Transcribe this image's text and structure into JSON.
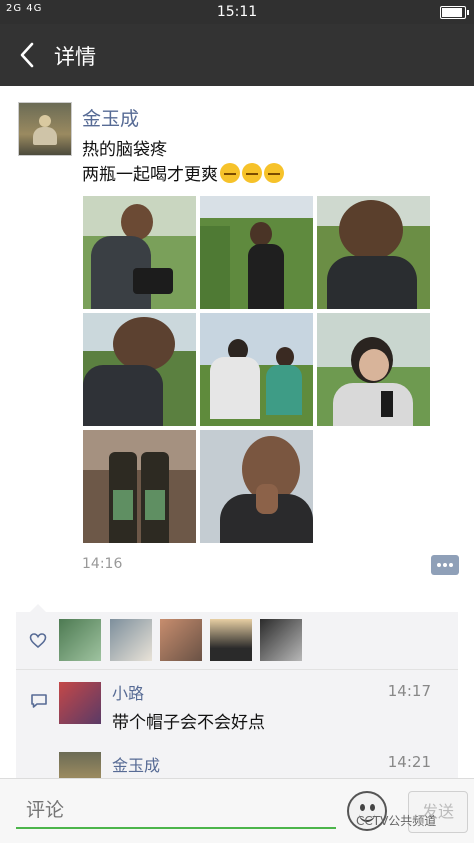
{
  "status_bar": {
    "signal": "2G 4G",
    "time": "15:11",
    "battery_level": 0.85
  },
  "nav": {
    "title": "详情"
  },
  "post": {
    "author": "金玉成",
    "lines": [
      "热的脑袋疼",
      "两瓶一起喝才更爽"
    ],
    "emoji_icons": [
      "grimace-emoji",
      "grimace-emoji",
      "grimace-emoji"
    ],
    "photos": [
      "man-with-camera-in-field",
      "cameraman-in-cornfield",
      "man-with-earphones-in-cornfield",
      "man-looking-down-in-field",
      "two-women-crouching-in-field",
      "woman-with-microphone",
      "two-bottles-on-table",
      "man-with-hand-at-mouth"
    ],
    "time": "14:16"
  },
  "likes": {
    "icon": "heart-icon",
    "avatars": [
      "like-avatar-1",
      "like-avatar-2",
      "like-avatar-3",
      "like-avatar-4",
      "like-avatar-5"
    ]
  },
  "comments": [
    {
      "author": "小路",
      "time": "14:17",
      "text": "带个帽子会不会好点"
    },
    {
      "author": "金玉成",
      "time": "14:21",
      "text": ""
    }
  ],
  "input": {
    "placeholder": "评论",
    "send_label": "发送"
  },
  "watermark": "CCTV公共频道",
  "colors": {
    "nav_bg": "#333333",
    "name_blue": "#576b95",
    "input_green": "#4cb54b"
  }
}
